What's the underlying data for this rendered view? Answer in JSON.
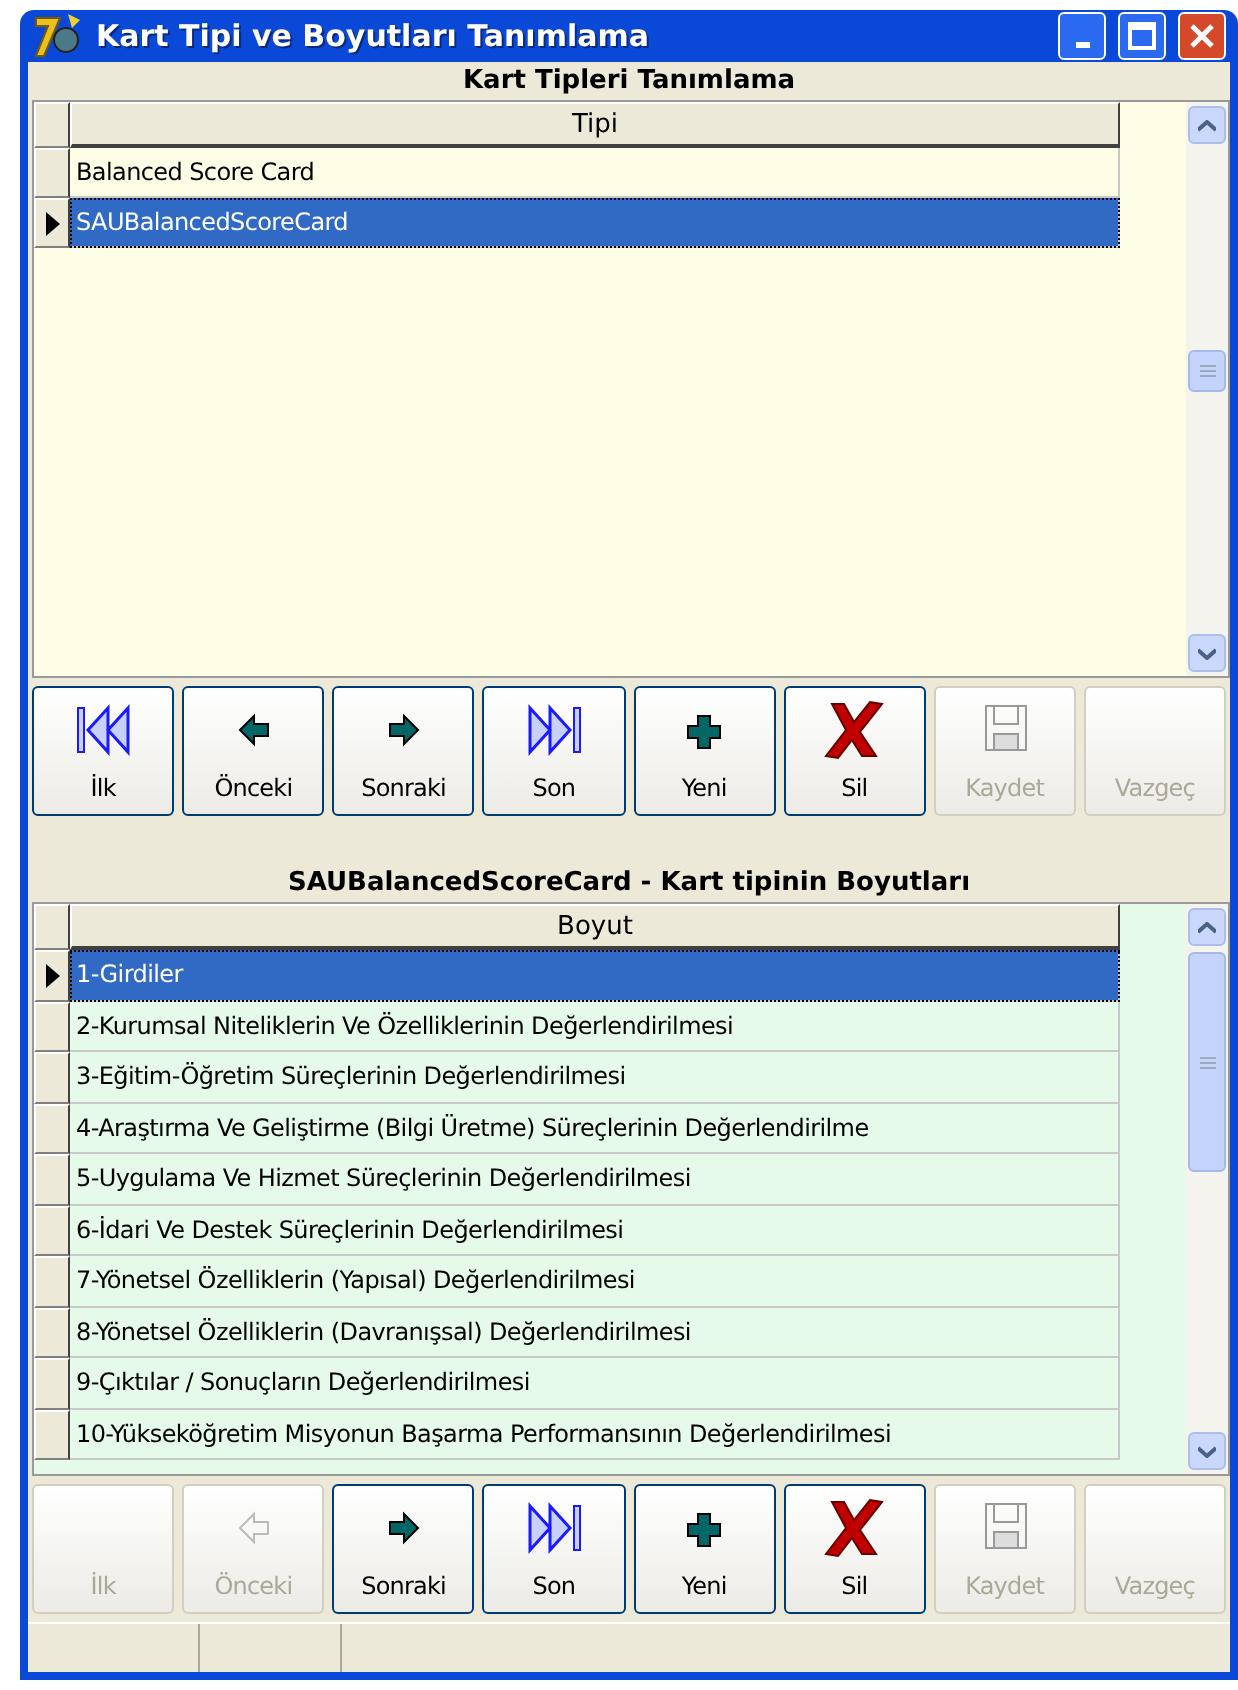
{
  "window": {
    "title": "Kart Tipi ve Boyutları Tanımlama"
  },
  "card_types": {
    "title": "Kart Tipleri Tanımlama",
    "column": "Tipi",
    "rows": [
      {
        "text": "Balanced Score Card",
        "selected": false
      },
      {
        "text": "SAUBalancedScoreCard",
        "selected": true
      }
    ],
    "buttons": [
      {
        "kind": "first",
        "label": "İlk",
        "disabled": false
      },
      {
        "kind": "prev",
        "label": "Önceki",
        "disabled": false
      },
      {
        "kind": "next",
        "label": "Sonraki",
        "disabled": false
      },
      {
        "kind": "last",
        "label": "Son",
        "disabled": false
      },
      {
        "kind": "new",
        "label": "Yeni",
        "disabled": false
      },
      {
        "kind": "delete",
        "label": "Sil",
        "disabled": false
      },
      {
        "kind": "save",
        "label": "Kaydet",
        "disabled": true
      },
      {
        "kind": "cancel",
        "label": "Vazgeç",
        "disabled": true
      }
    ]
  },
  "dimensions": {
    "title": "SAUBalancedScoreCard - Kart tipinin Boyutları",
    "column": "Boyut",
    "rows": [
      {
        "text": "1-Girdiler",
        "selected": true
      },
      {
        "text": "2-Kurumsal Niteliklerin Ve Özelliklerinin Değerlendirilmesi",
        "selected": false
      },
      {
        "text": "3-Eğitim-Öğretim Süreçlerinin Değerlendirilmesi",
        "selected": false
      },
      {
        "text": "4-Araştırma Ve Geliştirme (Bilgi Üretme) Süreçlerinin Değerlendirilme",
        "selected": false
      },
      {
        "text": "5-Uygulama Ve Hizmet Süreçlerinin Değerlendirilmesi",
        "selected": false
      },
      {
        "text": "6-İdari Ve Destek Süreçlerinin Değerlendirilmesi",
        "selected": false
      },
      {
        "text": "7-Yönetsel Özelliklerin (Yapısal) Değerlendirilmesi",
        "selected": false
      },
      {
        "text": "8-Yönetsel Özelliklerin (Davranışsal) Değerlendirilmesi",
        "selected": false
      },
      {
        "text": "9-Çıktılar / Sonuçların Değerlendirilmesi",
        "selected": false
      },
      {
        "text": "10-Yükseköğretim Misyonun Başarma Performansının Değerlendirilmesi",
        "selected": false
      }
    ],
    "buttons": [
      {
        "kind": "first",
        "label": "İlk",
        "disabled": true
      },
      {
        "kind": "prev",
        "label": "Önceki",
        "disabled": true
      },
      {
        "kind": "next",
        "label": "Sonraki",
        "disabled": false
      },
      {
        "kind": "last",
        "label": "Son",
        "disabled": false
      },
      {
        "kind": "new",
        "label": "Yeni",
        "disabled": false
      },
      {
        "kind": "delete",
        "label": "Sil",
        "disabled": false
      },
      {
        "kind": "save",
        "label": "Kaydet",
        "disabled": true
      },
      {
        "kind": "cancel",
        "label": "Vazgeç",
        "disabled": true
      }
    ]
  }
}
